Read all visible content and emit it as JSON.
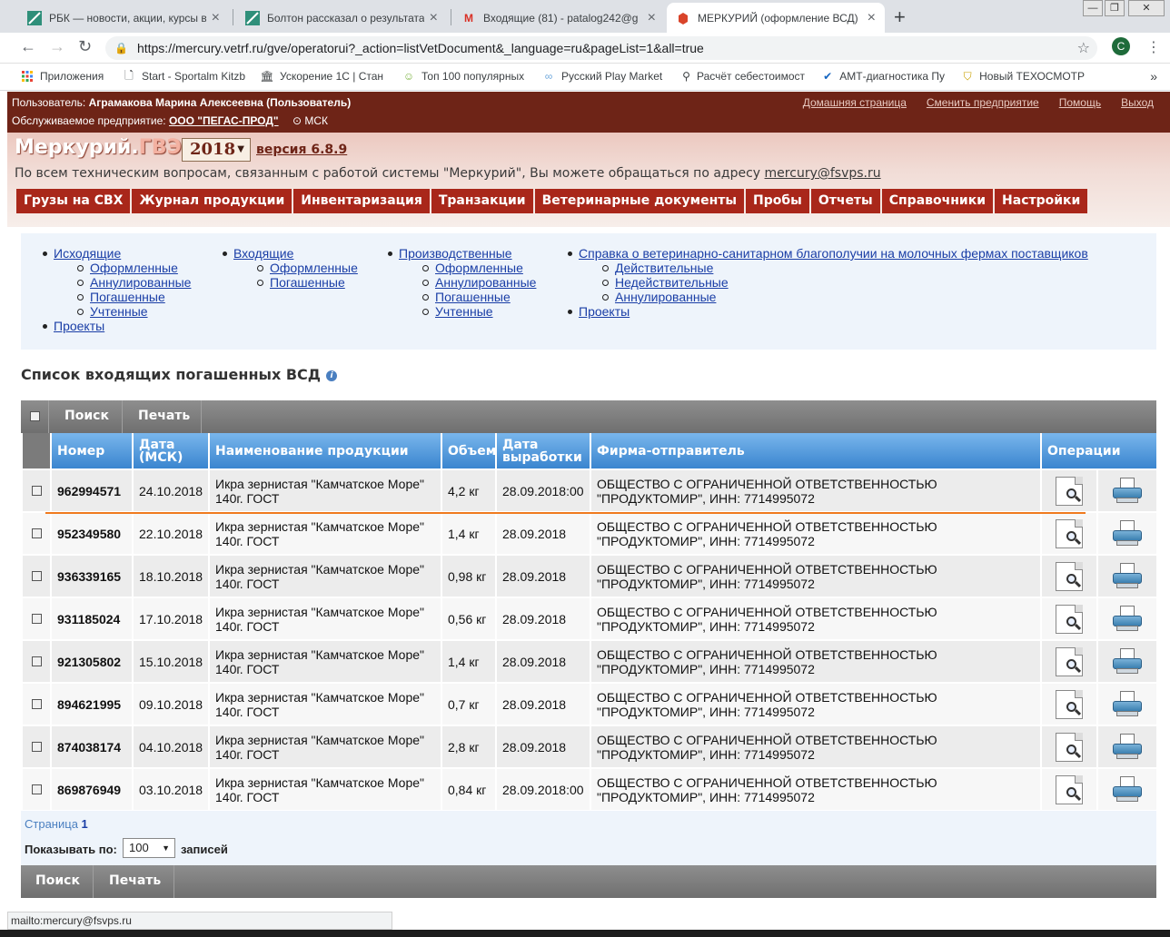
{
  "browser": {
    "tabs": [
      {
        "title": "РБК — новости, акции, курсы в",
        "icon": "rbc-icon"
      },
      {
        "title": "Болтон рассказал о результатах",
        "icon": "rbc-icon"
      },
      {
        "title": "Входящие (81) - patalog242@g",
        "icon": "gmail-icon"
      },
      {
        "title": "МЕРКУРИЙ (оформление ВСД)",
        "icon": "mercury-icon"
      }
    ],
    "url": "https://mercury.vetrf.ru/gve/operatorui?_action=listVetDocument&_language=ru&pageList=1&all=true",
    "profile_letter": "С",
    "bookmarks": [
      "Приложения",
      "Start - Sportalm Kitzb",
      "Ускорение 1С | Стан",
      "Топ 100 популярных",
      "Русский Play Market",
      "Расчёт себестоимост",
      "АМТ-диагностика Пу",
      "Новый ТЕХОСМОТР"
    ]
  },
  "header": {
    "user_label": "Пользователь:",
    "user_name": "Аграмакова Марина Алексеевна (Пользователь)",
    "enterprise_label": "Обслуживаемое предприятие:",
    "enterprise_name": "ООО \"ПЕГАС-ПРОД\"",
    "timezone": "МСК",
    "links": [
      "Домашняя страница",
      "Сменить предприятие",
      "Помощь",
      "Выход"
    ]
  },
  "brand": {
    "logo_main": "Меркурий.",
    "logo_suffix": "ГВЭ",
    "year": "2018",
    "version": "версия 6.8.9",
    "support_text": "По всем техническим вопросам, связанным с работой системы \"Меркурий\", Вы можете обращаться по адресу",
    "support_email": "mercury@fsvps.ru"
  },
  "main_nav": [
    "Грузы на СВХ",
    "Журнал продукции",
    "Инвентаризация",
    "Транзакции",
    "Ветеринарные документы",
    "Пробы",
    "Отчеты",
    "Справочники",
    "Настройки"
  ],
  "submenu": {
    "outgoing": {
      "label": "Исходящие",
      "items": [
        "Оформленные",
        "Аннулированные",
        "Погашенные",
        "Учтенные"
      ],
      "projects": "Проекты"
    },
    "incoming": {
      "label": "Входящие",
      "items": [
        "Оформленные",
        "Погашенные"
      ]
    },
    "production": {
      "label": "Производственные",
      "items": [
        "Оформленные",
        "Аннулированные",
        "Погашенные",
        "Учтенные"
      ]
    },
    "reference": {
      "label": "Справка о ветеринарно-санитарном благополучии на молочных фермах поставщиков",
      "items": [
        "Действительные",
        "Недействительные",
        "Аннулированные"
      ],
      "projects": "Проекты"
    }
  },
  "page_title": "Список входящих погашенных ВСД",
  "toolbar": {
    "search": "Поиск",
    "print": "Печать"
  },
  "table": {
    "columns": {
      "number": "Номер",
      "date_1": "Дата",
      "date_2": "(МСК)",
      "product": "Наименование продукции",
      "volume": "Объем",
      "prod_date_1": "Дата",
      "prod_date_2": "выработки",
      "sender": "Фирма-отправитель",
      "ops": "Операции"
    },
    "rows": [
      {
        "number": "962994571",
        "date": "24.10.2018",
        "product_1": "Икра зернистая \"Камчатское Море\"",
        "product_2": "140г. ГОСТ",
        "volume": "4,2 кг",
        "prod_date": "28.09.2018:00",
        "sender_1": "ОБЩЕСТВО С ОГРАНИЧЕННОЙ ОТВЕТСТВЕННОСТЬЮ",
        "sender_2": "\"ПРОДУКТОМИР\", ИНН: 7714995072"
      },
      {
        "number": "952349580",
        "date": "22.10.2018",
        "product_1": "Икра зернистая \"Камчатское Море\"",
        "product_2": "140г. ГОСТ",
        "volume": "1,4 кг",
        "prod_date": "28.09.2018",
        "sender_1": "ОБЩЕСТВО С ОГРАНИЧЕННОЙ ОТВЕТСТВЕННОСТЬЮ",
        "sender_2": "\"ПРОДУКТОМИР\", ИНН: 7714995072"
      },
      {
        "number": "936339165",
        "date": "18.10.2018",
        "product_1": "Икра зернистая \"Камчатское Море\"",
        "product_2": "140г. ГОСТ",
        "volume": "0,98 кг",
        "prod_date": "28.09.2018",
        "sender_1": "ОБЩЕСТВО С ОГРАНИЧЕННОЙ ОТВЕТСТВЕННОСТЬЮ",
        "sender_2": "\"ПРОДУКТОМИР\", ИНН: 7714995072"
      },
      {
        "number": "931185024",
        "date": "17.10.2018",
        "product_1": "Икра зернистая \"Камчатское Море\"",
        "product_2": "140г. ГОСТ",
        "volume": "0,56 кг",
        "prod_date": "28.09.2018",
        "sender_1": "ОБЩЕСТВО С ОГРАНИЧЕННОЙ ОТВЕТСТВЕННОСТЬЮ",
        "sender_2": "\"ПРОДУКТОМИР\", ИНН: 7714995072"
      },
      {
        "number": "921305802",
        "date": "15.10.2018",
        "product_1": "Икра зернистая \"Камчатское Море\"",
        "product_2": "140г. ГОСТ",
        "volume": "1,4 кг",
        "prod_date": "28.09.2018",
        "sender_1": "ОБЩЕСТВО С ОГРАНИЧЕННОЙ ОТВЕТСТВЕННОСТЬЮ",
        "sender_2": "\"ПРОДУКТОМИР\", ИНН: 7714995072"
      },
      {
        "number": "894621995",
        "date": "09.10.2018",
        "product_1": "Икра зернистая \"Камчатское Море\"",
        "product_2": "140г. ГОСТ",
        "volume": "0,7 кг",
        "prod_date": "28.09.2018",
        "sender_1": "ОБЩЕСТВО С ОГРАНИЧЕННОЙ ОТВЕТСТВЕННОСТЬЮ",
        "sender_2": "\"ПРОДУКТОМИР\", ИНН: 7714995072"
      },
      {
        "number": "874038174",
        "date": "04.10.2018",
        "product_1": "Икра зернистая \"Камчатское Море\"",
        "product_2": "140г. ГОСТ",
        "volume": "2,8 кг",
        "prod_date": "28.09.2018",
        "sender_1": "ОБЩЕСТВО С ОГРАНИЧЕННОЙ ОТВЕТСТВЕННОСТЬЮ",
        "sender_2": "\"ПРОДУКТОМИР\", ИНН: 7714995072"
      },
      {
        "number": "869876949",
        "date": "03.10.2018",
        "product_1": "Икра зернистая \"Камчатское Море\"",
        "product_2": "140г. ГОСТ",
        "volume": "0,84 кг",
        "prod_date": "28.09.2018:00",
        "sender_1": "ОБЩЕСТВО С ОГРАНИЧЕННОЙ ОТВЕТСТВЕННОСТЬЮ",
        "sender_2": "\"ПРОДУКТОМИР\", ИНН: 7714995072"
      }
    ]
  },
  "pager": {
    "page_label": "Страница",
    "page_num": "1",
    "show_label": "Показывать по:",
    "per_page": "100",
    "records_label": "записей"
  },
  "status_bar": "mailto:mercury@fsvps.ru"
}
